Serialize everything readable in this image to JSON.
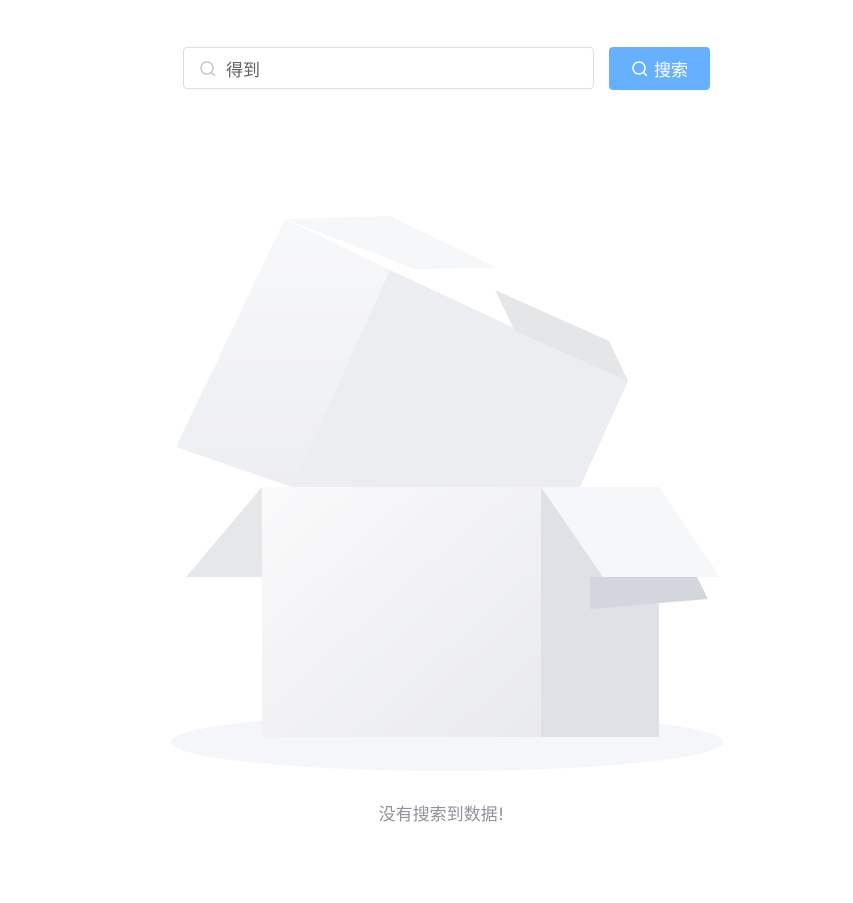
{
  "search": {
    "value": "得到",
    "icon": "search-icon",
    "button_label": "搜索",
    "button_icon": "search-icon",
    "button_color": "#66b1ff"
  },
  "empty": {
    "illustration": "empty-box-illustration",
    "message": "没有搜索到数据!"
  }
}
